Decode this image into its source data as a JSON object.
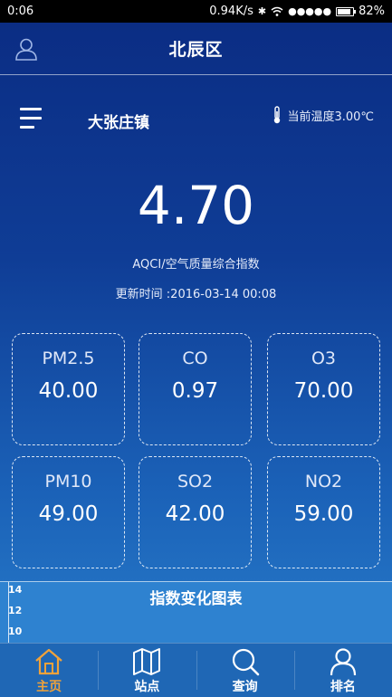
{
  "status_bar": {
    "time": "0:06",
    "network_speed": "0.94K/s",
    "signal": "●●●●●",
    "battery": "82%"
  },
  "titlebar": {
    "title": "北辰区",
    "user_icon": "user-icon"
  },
  "header": {
    "menu_icon": "menu-icon",
    "town": "大张庄镇",
    "thermometer_icon": "thermometer-icon",
    "temperature": "当前温度3.00℃"
  },
  "index": {
    "value": "4.70",
    "label": "AQCI/空气质量综合指数",
    "update_time": "更新时间 :2016-03-14 00:08"
  },
  "pollutants": [
    {
      "name": "PM2.5",
      "value": "40.00"
    },
    {
      "name": "CO",
      "value": "0.97"
    },
    {
      "name": "O3",
      "value": "70.00"
    },
    {
      "name": "PM10",
      "value": "49.00"
    },
    {
      "name": "SO2",
      "value": "42.00"
    },
    {
      "name": "NO2",
      "value": "59.00"
    }
  ],
  "chart": {
    "title": "指数变化图表",
    "y_ticks": [
      "14",
      "12",
      "10"
    ]
  },
  "tabs": [
    {
      "label": "主页",
      "icon": "home-icon",
      "active": true
    },
    {
      "label": "站点",
      "icon": "map-icon",
      "active": false
    },
    {
      "label": "查询",
      "icon": "search-icon",
      "active": false
    },
    {
      "label": "排名",
      "icon": "person-icon",
      "active": false
    }
  ],
  "colors": {
    "background_top": "#0b2d84",
    "background_bottom": "#2a80cd",
    "active_tab": "#f0a23a",
    "tabbar": "#1f67b5"
  }
}
